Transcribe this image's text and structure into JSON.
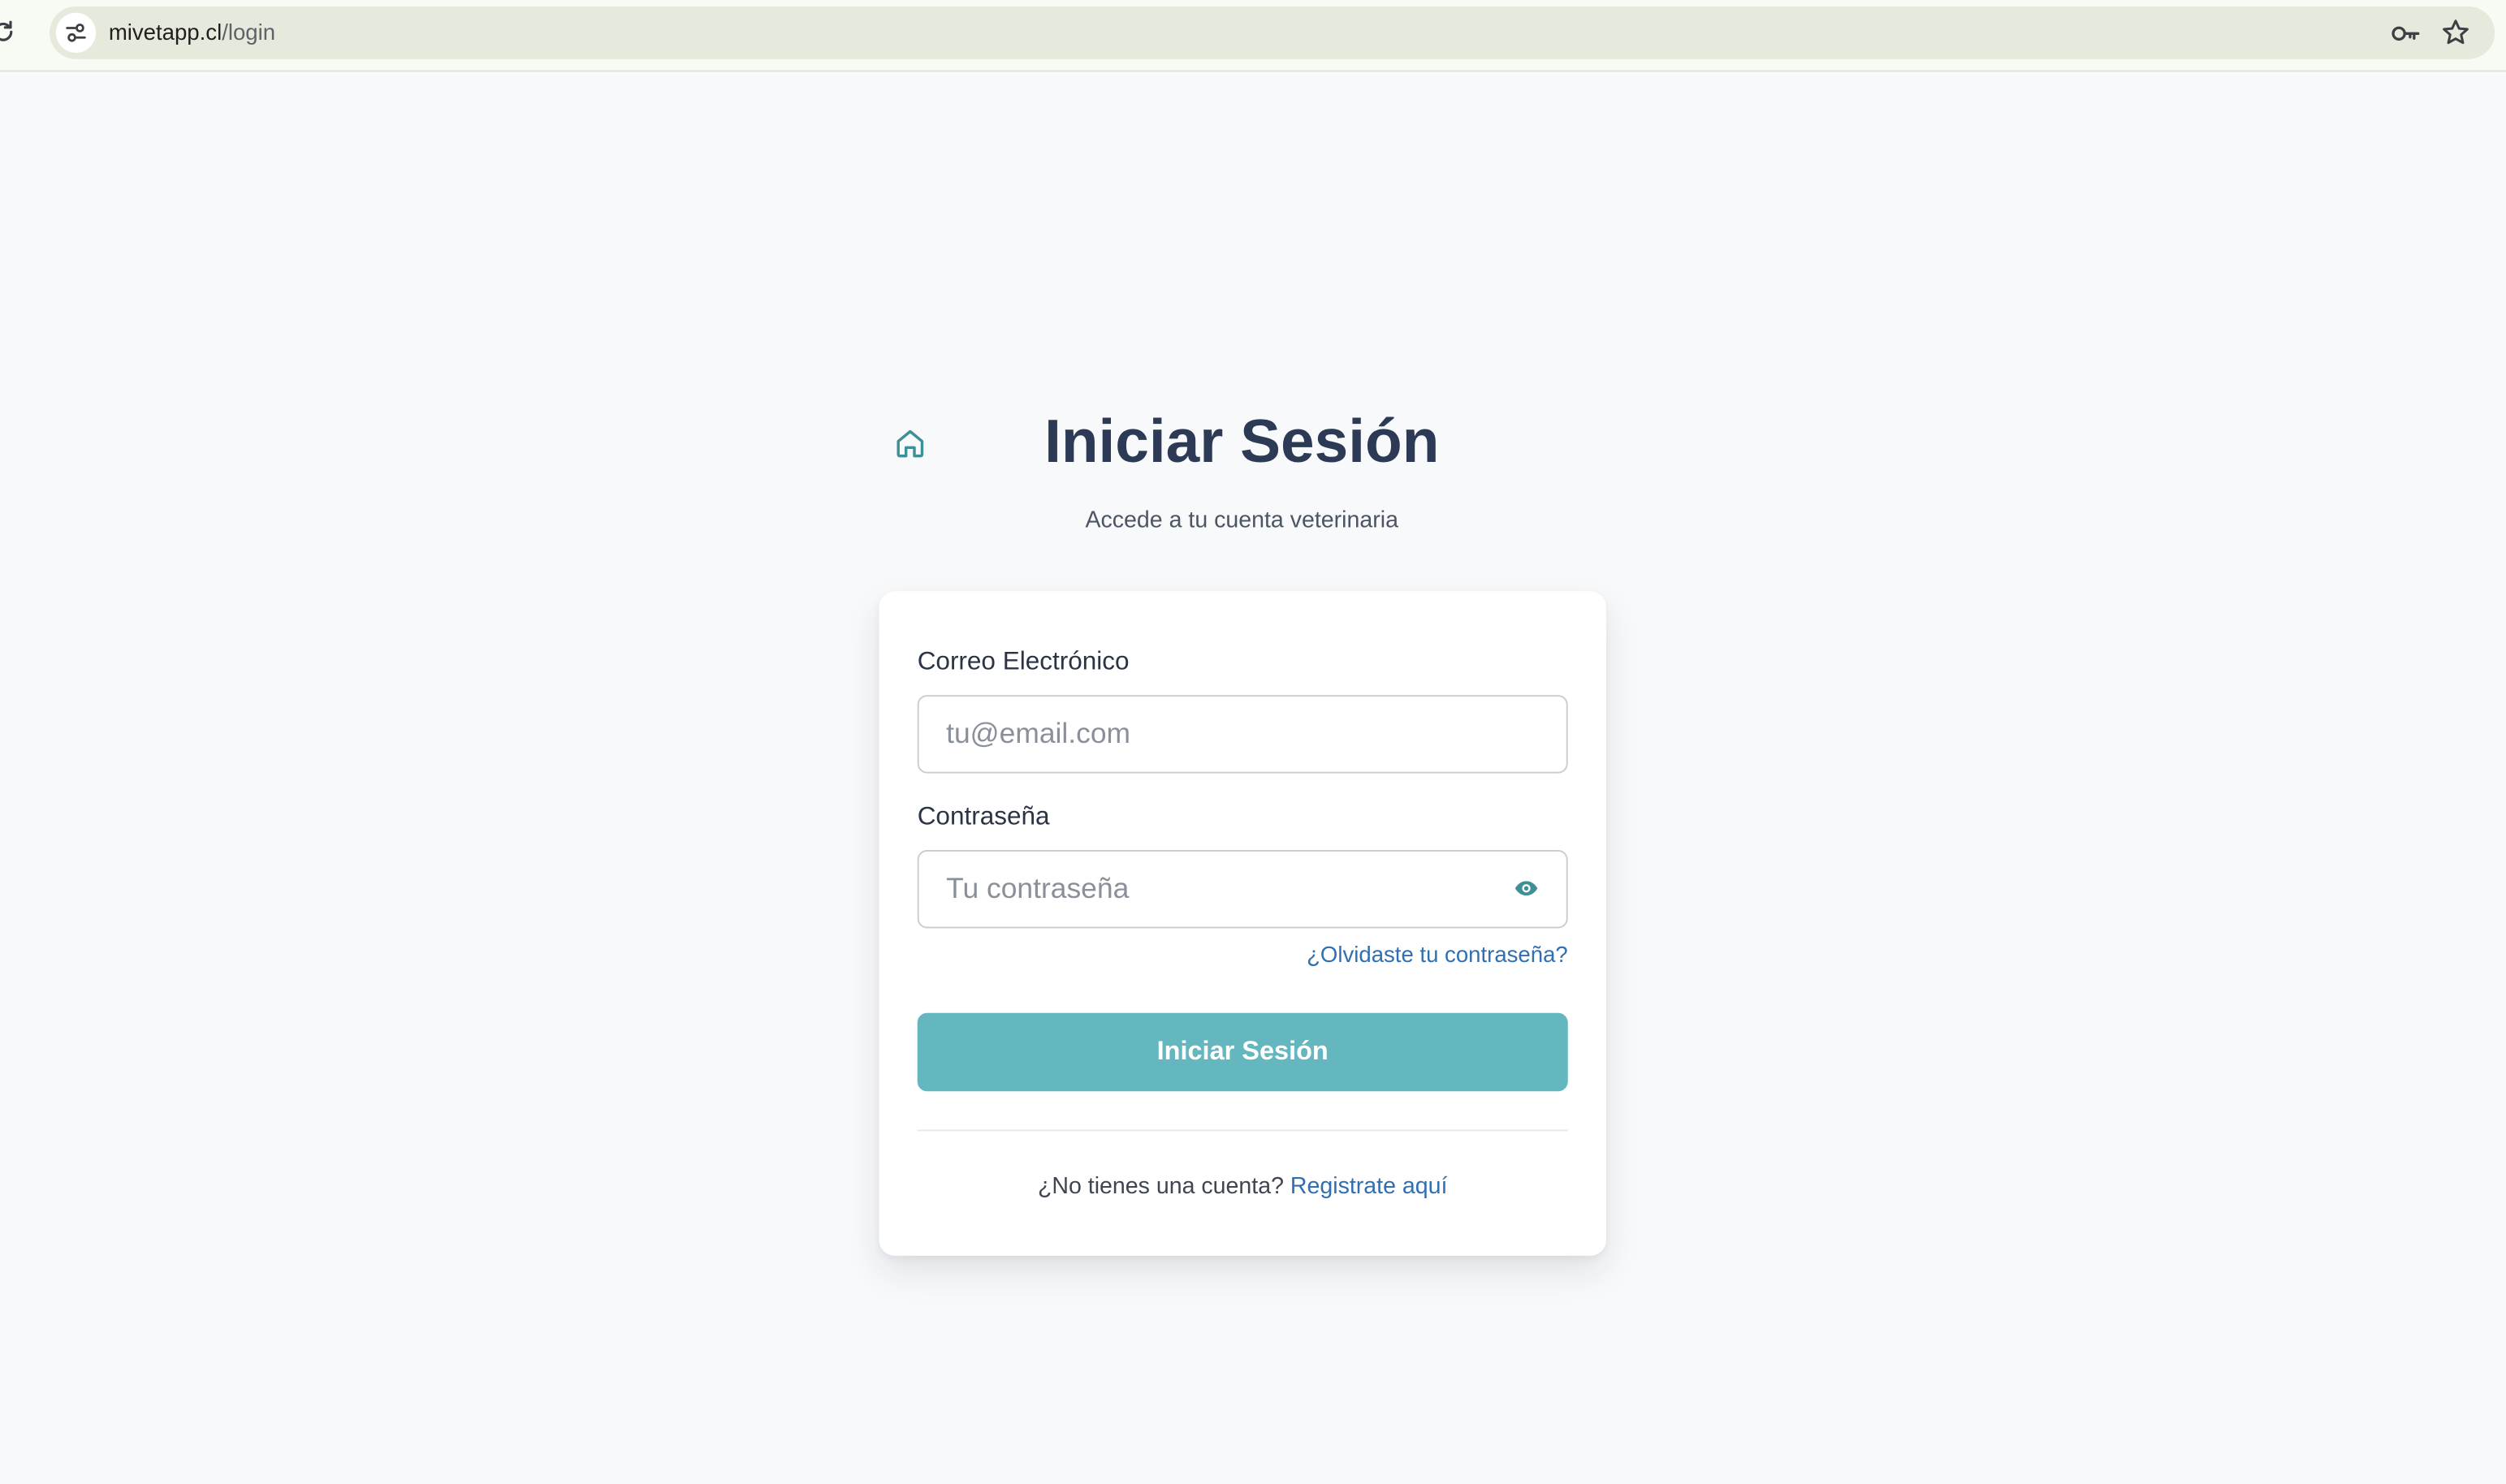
{
  "browser": {
    "url_host": "mivetapp.cl",
    "url_path": "/login"
  },
  "header": {
    "title": "Iniciar Sesión",
    "subtitle": "Accede a tu cuenta veterinaria"
  },
  "form": {
    "email": {
      "label": "Correo Electrónico",
      "placeholder": "tu@email.com",
      "value": ""
    },
    "password": {
      "label": "Contraseña",
      "placeholder": "Tu contraseña",
      "value": ""
    },
    "forgot_link": "¿Olvidaste tu contraseña?",
    "submit_label": "Iniciar Sesión"
  },
  "signup": {
    "prompt": "¿No tienes una cuenta?",
    "link": "Registrate aquí"
  },
  "icons": {
    "reload": "reload-icon",
    "site_info": "tune-icon",
    "password_manager": "key-icon",
    "bookmark": "star-icon",
    "home": "home-icon",
    "show_password": "eye-icon"
  },
  "colors": {
    "title": "#2d3a55",
    "accent_teal": "#64b6bf",
    "link": "#2f6fb3",
    "home_icon": "#3f8f96"
  }
}
